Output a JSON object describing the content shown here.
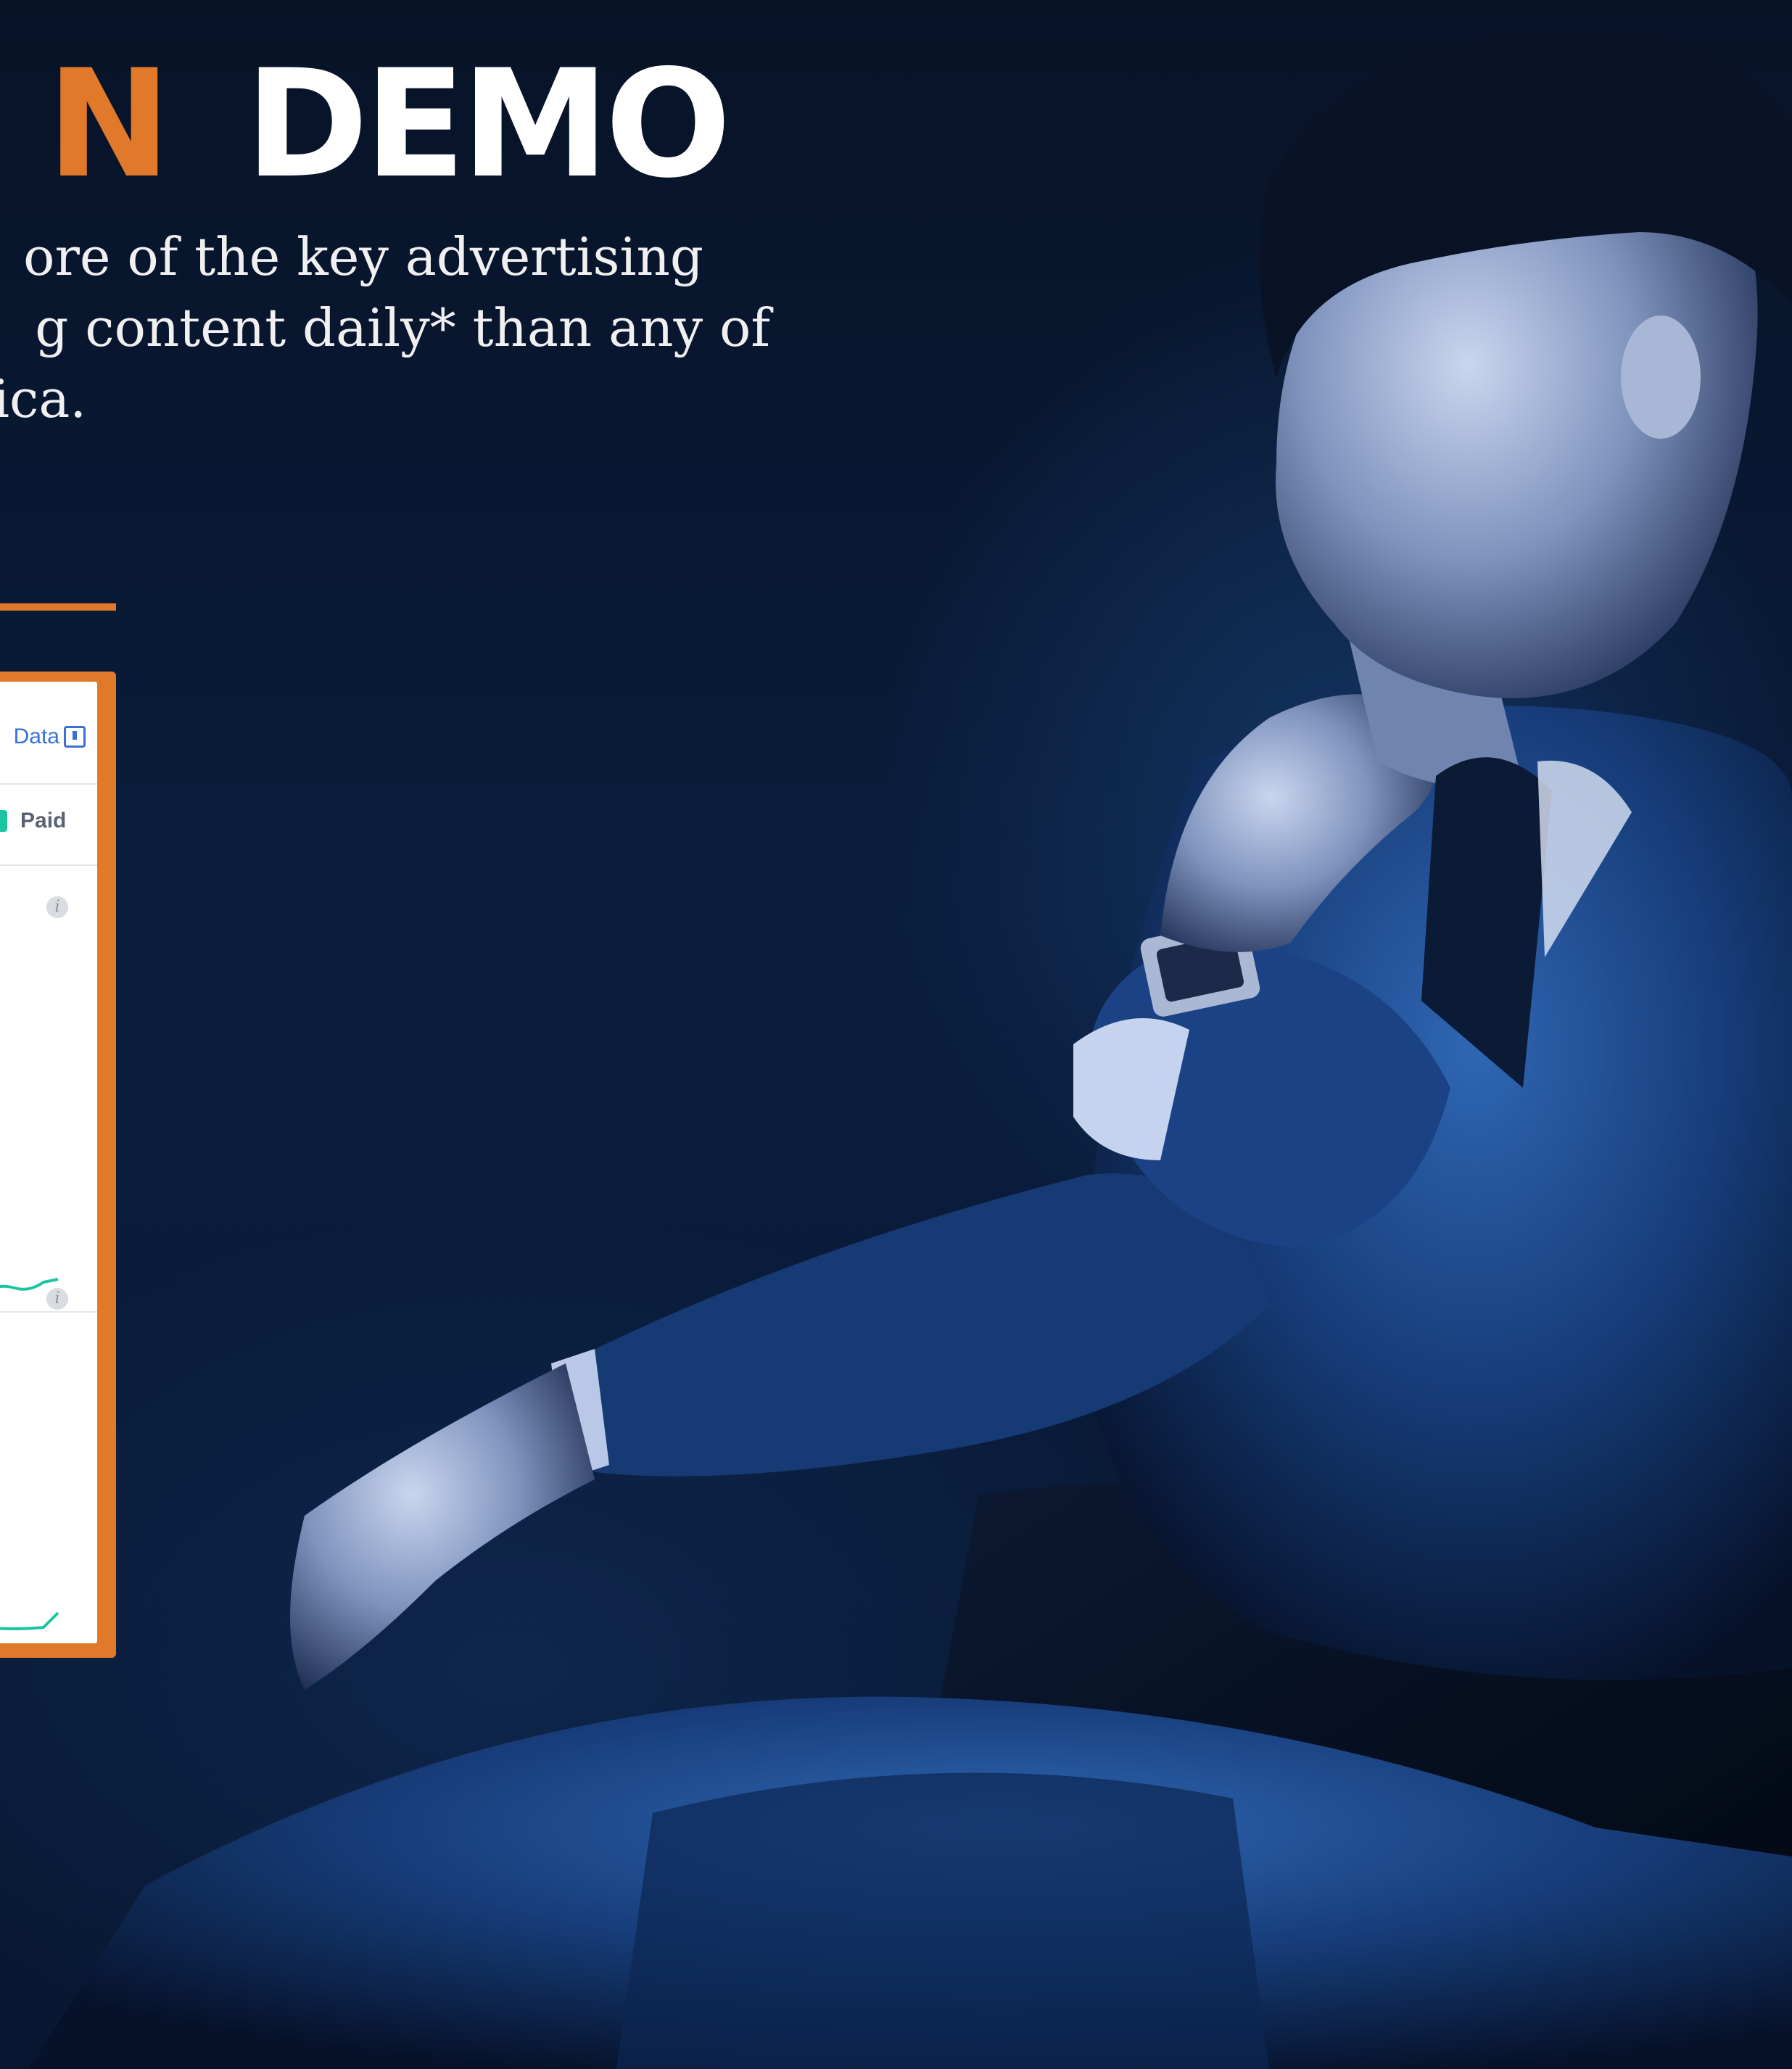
{
  "headline": {
    "accent_part": "N",
    "main_part": "DEMO",
    "accent_color": "#e07a2a"
  },
  "intro": {
    "line1": "ore of the key advertising",
    "line2": "g content daily* than any of",
    "line3": "ica."
  },
  "dashboard": {
    "data_button_label": "Data",
    "download_icon": "download-icon",
    "legend_paid_label": "Paid",
    "legend_paid_color": "#1cc4a0",
    "info_icon": "info-icon"
  }
}
